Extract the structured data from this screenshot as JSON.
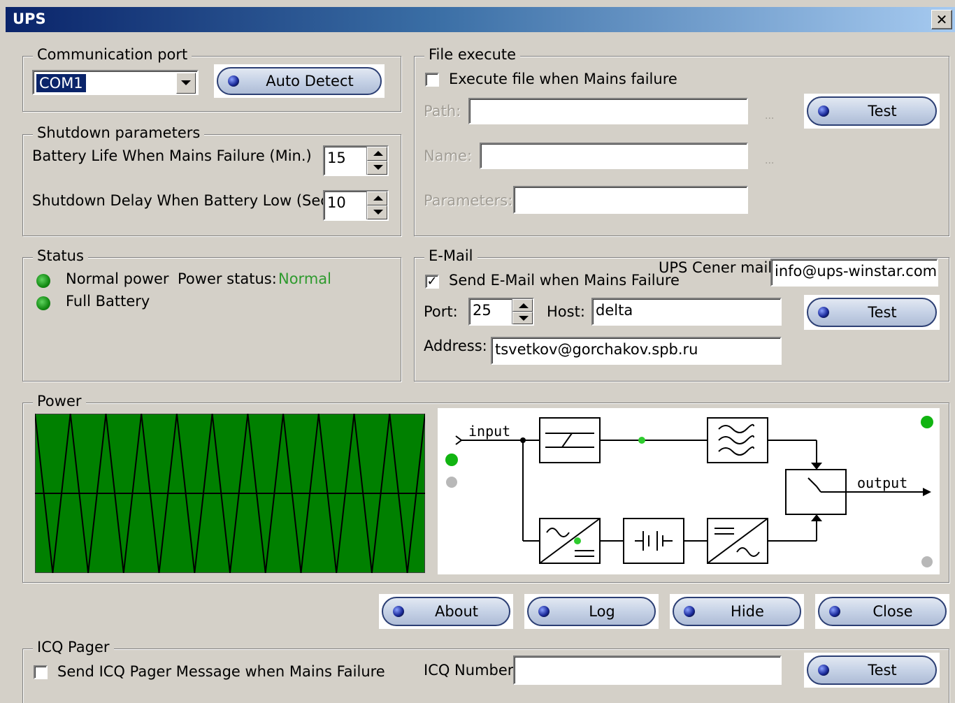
{
  "window": {
    "title": "UPS",
    "close_glyph": "✕"
  },
  "comm": {
    "legend": "Communication port",
    "port_value": "COM1",
    "auto_detect": "Auto Detect"
  },
  "shutdown": {
    "legend": "Shutdown parameters",
    "battery_label": "Battery Life When Mains Failure (Min.)",
    "battery_value": "15",
    "delay_label": "Shutdown Delay When Battery Low (Sec.)",
    "delay_value": "10"
  },
  "status": {
    "legend": "Status",
    "normal_power": "Normal power",
    "power_status_label": "Power status:",
    "power_status_value": "Normal",
    "full_battery": "Full Battery",
    "status_color": "#2e9a2e"
  },
  "file_exec": {
    "legend": "File execute",
    "execute_label": "Execute file when Mains failure",
    "execute_checked": false,
    "path_label": "Path:",
    "path_value": "",
    "name_label": "Name:",
    "name_value": "",
    "params_label": "Parameters:",
    "params_value": "",
    "browse": "...",
    "test": "Test"
  },
  "email": {
    "legend": "E-Mail",
    "send_label": "Send E-Mail when Mains Failure",
    "send_checked": true,
    "check_glyph": "✓",
    "center_label": "UPS Cener mail",
    "center_value": "info@ups-winstar.com",
    "port_label": "Port:",
    "port_value": "25",
    "host_label": "Host:",
    "host_value": "delta",
    "address_label": "Address:",
    "address_value": "tsvetkov@gorchakov.spb.ru",
    "test": "Test"
  },
  "power": {
    "legend": "Power",
    "diagram_input": "input",
    "diagram_output": "output",
    "wave_color": "#008000"
  },
  "buttons": {
    "about": "About",
    "log": "Log",
    "hide": "Hide",
    "close": "Close"
  },
  "icq": {
    "legend": "ICQ Pager",
    "send_label": "Send ICQ Pager Message when Mains Failure",
    "send_checked": false,
    "number_label": "ICQ Number:",
    "number_value": "",
    "test": "Test"
  }
}
